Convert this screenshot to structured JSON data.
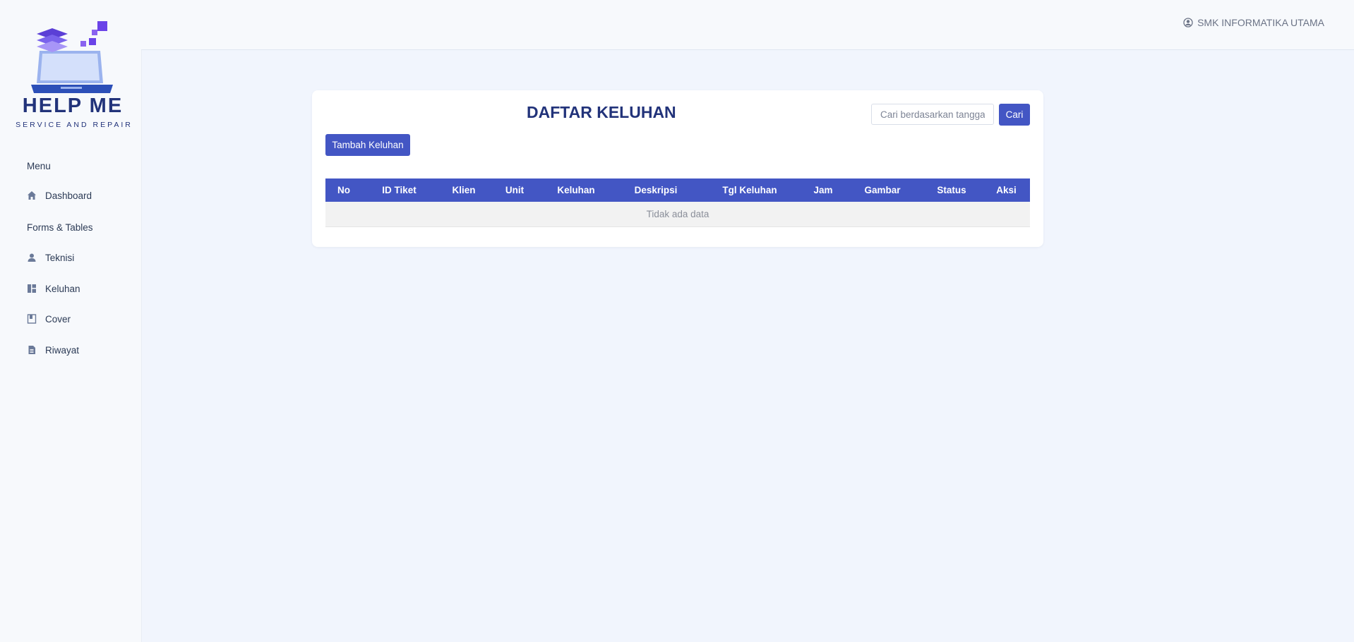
{
  "brand": {
    "name": "HELP ME",
    "tagline": "SERVICE AND REPAIR"
  },
  "sidebar": {
    "sections": [
      {
        "label": "Menu"
      },
      {
        "label": "Forms & Tables"
      }
    ],
    "items": [
      {
        "label": "Dashboard",
        "icon": "home-icon"
      },
      {
        "label": "Teknisi",
        "icon": "user-icon"
      },
      {
        "label": "Keluhan",
        "icon": "dashboard-layout-icon"
      },
      {
        "label": "Cover",
        "icon": "book-icon"
      },
      {
        "label": "Riwayat",
        "icon": "document-icon"
      }
    ]
  },
  "header": {
    "user": "SMK INFORMATIKA UTAMA",
    "user_icon": "user-circle-icon"
  },
  "main": {
    "title": "DAFTAR KELUHAN",
    "search_placeholder": "Cari berdasarkan tanggal",
    "search_button": "Cari",
    "add_button": "Tambah Keluhan",
    "table": {
      "columns": [
        "No",
        "ID Tiket",
        "Klien",
        "Unit",
        "Keluhan",
        "Deskripsi",
        "Tgl Keluhan",
        "Jam",
        "Gambar",
        "Status",
        "Aksi"
      ],
      "empty_text": "Tidak ada data"
    }
  },
  "colors": {
    "primary": "#4356c4",
    "brand": "#22337a",
    "background": "#f1f5fd"
  }
}
